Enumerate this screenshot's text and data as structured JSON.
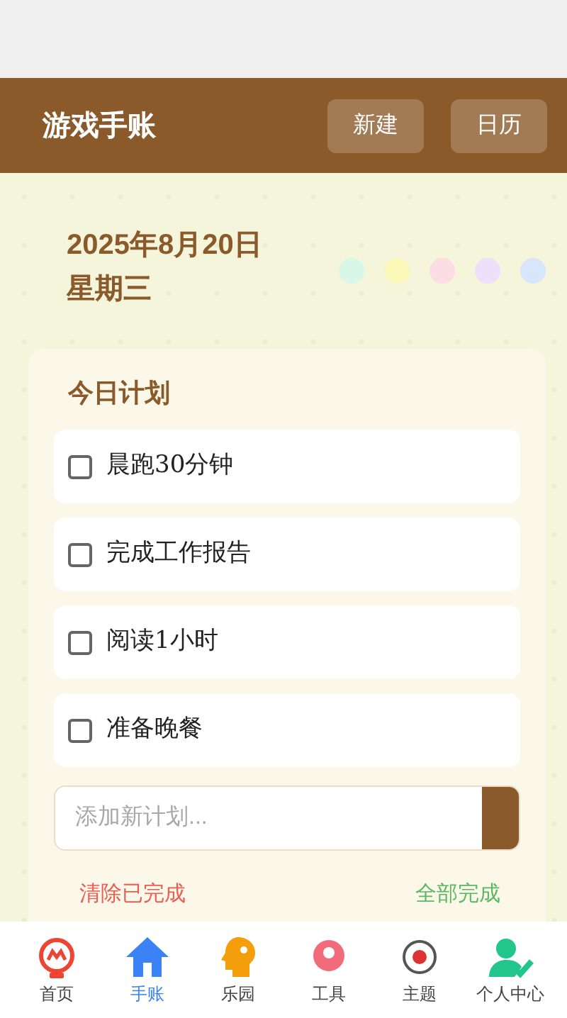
{
  "header": {
    "title": "游戏手账",
    "buttons": [
      "新建",
      "日历"
    ]
  },
  "date": {
    "date": "2025年8月20日",
    "weekday": "星期三"
  },
  "color_dots": [
    {
      "color": "#d8f7e6"
    },
    {
      "color": "#fbf7b8"
    },
    {
      "color": "#fbdde3"
    },
    {
      "color": "#eedffb"
    },
    {
      "color": "#d7e6fb"
    }
  ],
  "plan": {
    "title": "今日计划",
    "tasks": [
      {
        "text": "晨跑30分钟",
        "checked": false
      },
      {
        "text": "完成工作报告",
        "checked": false
      },
      {
        "text": "阅读1小时",
        "checked": false
      },
      {
        "text": "准备晚餐",
        "checked": false
      }
    ],
    "input": {
      "placeholder": "添加新计划..."
    },
    "actions": [
      "清除已完成",
      "全部完成"
    ]
  },
  "nav": [
    {
      "label": "首页",
      "kind": "home",
      "selected": false
    },
    {
      "label": "手账",
      "kind": "house",
      "selected": true
    },
    {
      "label": "乐园",
      "kind": "head",
      "selected": false
    },
    {
      "label": "工具",
      "kind": "tool",
      "selected": false
    },
    {
      "label": "主题",
      "kind": "theme",
      "selected": false
    },
    {
      "label": "个人中心",
      "kind": "person",
      "selected": false
    }
  ]
}
